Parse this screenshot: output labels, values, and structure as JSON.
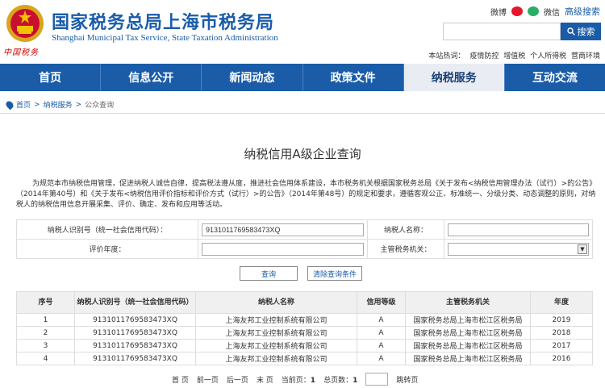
{
  "header": {
    "title_cn": "国家税务总局上海市税务局",
    "title_en": "Shanghai Municipal Tax Service, State Taxation Administration",
    "seal_text": "中国税务",
    "weibo": "微博",
    "wechat": "微信",
    "advanced_search": "高级搜索",
    "search_placeholder": "",
    "search_button": "搜索",
    "hot_label": "本站热词：",
    "hot_words": [
      "疫情防控",
      "增值税",
      "个人所得税",
      "营商环境"
    ]
  },
  "nav": {
    "items": [
      {
        "label": "首页"
      },
      {
        "label": "信息公开"
      },
      {
        "label": "新闻动态"
      },
      {
        "label": "政策文件"
      },
      {
        "label": "纳税服务"
      },
      {
        "label": "互动交流"
      }
    ]
  },
  "breadcrumb": {
    "home": "首页",
    "sep": ">",
    "section": "纳税服务",
    "current": "公众查询"
  },
  "page": {
    "title": "纳税信用A级企业查询",
    "intro": "为规范本市纳税信用管理，促进纳税人诚信自律，提高税法遵从度，推进社会信用体系建设，本市税务机关根据国家税务总局《关于发布<纳税信用管理办法（试行）>的公告》（2014年第40号）和《关于发布<纳税信用评价指标和评价方式（试行）>的公告》（2014年第48号）的规定和要求，遵循客观公正、标准统一、分级分类、动态调整的原则，对纳税人的纳税信用信息开展采集、评价、确定、发布和应用等活动。"
  },
  "form": {
    "taxpayer_id_label": "纳税人识别号（统一社会信用代码）：",
    "taxpayer_id_value": "913101176958347​3XQ",
    "taxpayer_name_label": "纳税人名称：",
    "taxpayer_name_value": "",
    "year_label": "评价年度：",
    "year_value": "",
    "authority_label": "主管税务机关：",
    "authority_value": "",
    "dropdown_glyph": "▼",
    "query_button": "查询",
    "clear_button": "清除查询条件"
  },
  "results": {
    "headers": [
      "序号",
      "纳税人识别号（统一社会信用代码）",
      "纳税人名称",
      "信用等级",
      "主管税务机关",
      "年度"
    ],
    "rows": [
      [
        "1",
        "913101176958347​3XQ",
        "上海友邦工业控制系统有限公司",
        "A",
        "国家税务总局上海市松江区税务局",
        "2019"
      ],
      [
        "2",
        "913101176958347​3XQ",
        "上海友邦工业控制系统有限公司",
        "A",
        "国家税务总局上海市松江区税务局",
        "2018"
      ],
      [
        "3",
        "913101176958347​3XQ",
        "上海友邦工业控制系统有限公司",
        "A",
        "国家税务总局上海市松江区税务局",
        "2017"
      ],
      [
        "4",
        "913101176958347​3XQ",
        "上海友邦工业控制系统有限公司",
        "A",
        "国家税务总局上海市松江区税务局",
        "2016"
      ]
    ]
  },
  "pager": {
    "first": "首 页",
    "prev": "前一页",
    "next": "后一页",
    "last": "末 页",
    "current_label": "当前页：",
    "current": "1",
    "total_label": "总页数：",
    "total": "1",
    "jump": "跳转页"
  },
  "colors": {
    "brand": "#1a5ca8",
    "nav_active_bg": "#e9edf3"
  }
}
